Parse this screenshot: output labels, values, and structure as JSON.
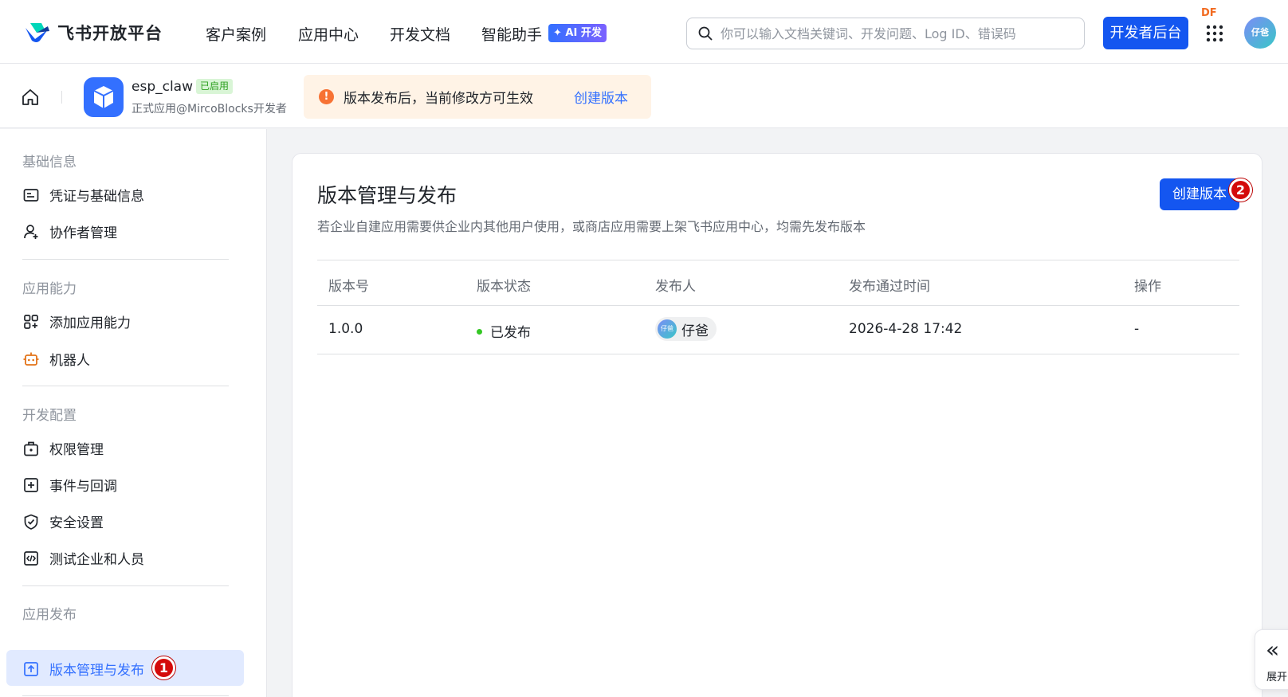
{
  "brand": {
    "name": "飞书开放平台"
  },
  "nav": {
    "items": [
      "客户案例",
      "应用中心",
      "开发文档",
      "智能助手"
    ],
    "ai_badge": "✦ AI 开发",
    "search_placeholder": "你可以输入文档关键词、开发问题、Log ID、错误码",
    "dev_console": "开发者后台",
    "df_label": "DF",
    "avatar_text": "仔爸"
  },
  "app": {
    "name": "esp_claw",
    "status": "已启用",
    "subtitle": "正式应用@MircoBlocks开发者",
    "notice_text": "版本发布后，当前修改方可生效",
    "notice_link": "创建版本"
  },
  "sidebar": {
    "sections": [
      {
        "title": "基础信息",
        "items": [
          "凭证与基础信息",
          "协作者管理"
        ]
      },
      {
        "title": "应用能力",
        "items": [
          "添加应用能力",
          "机器人"
        ]
      },
      {
        "title": "开发配置",
        "items": [
          "权限管理",
          "事件与回调",
          "安全设置",
          "测试企业和人员"
        ]
      },
      {
        "title": "应用发布",
        "items": [
          "版本管理与发布"
        ]
      }
    ],
    "active_badge": "1"
  },
  "main": {
    "title": "版本管理与发布",
    "description": "若企业自建应用需要供企业内其他用户使用，或商店应用需要上架飞书应用中心，均需先发布版本",
    "create_button": "创建版本",
    "create_badge": "2",
    "table": {
      "headers": [
        "版本号",
        "版本状态",
        "发布人",
        "发布通过时间",
        "操作"
      ],
      "rows": [
        {
          "version": "1.0.0",
          "status": "已发布",
          "publisher": "仔爸",
          "publisher_avatar": "仔爸",
          "time": "2026-4-28 17:42",
          "action": "-"
        }
      ]
    }
  },
  "expand_tab": {
    "icon": "«",
    "label": "展开"
  },
  "colors": {
    "primary": "#1456f0",
    "link": "#3370ff",
    "warning": "#f77234",
    "success": "#34c724",
    "badge_red": "#d40a0a"
  }
}
